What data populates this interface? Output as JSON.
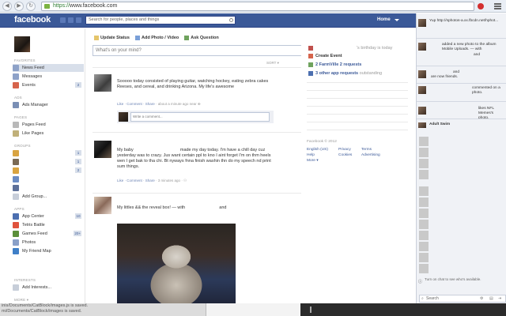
{
  "browser": {
    "url_scheme": "https://",
    "url_rest": "www.facebook.com",
    "back": "◀",
    "forward": "▶",
    "reload": "↻"
  },
  "header": {
    "logo": "facebook",
    "search_placeholder": "Search for people, places and things",
    "home": "Home"
  },
  "left": {
    "favorites_label": "FAVORITES",
    "favorites": [
      {
        "label": "News Feed",
        "count": ""
      },
      {
        "label": "Messages",
        "count": ""
      },
      {
        "label": "Events",
        "count": "2"
      }
    ],
    "ads_label": "ADS",
    "ads_manager": "Ads Manager",
    "pages_label": "PAGES",
    "pages_feed": "Pages Feed",
    "like_pages": "Like Pages",
    "groups_label": "GROUPS",
    "group_counts": [
      "1",
      "1",
      "2",
      ""
    ],
    "add_group": "Add Group...",
    "apps_label": "APPS",
    "apps": [
      {
        "label": "App Center",
        "count": "10"
      },
      {
        "label": "Tetris Battle",
        "count": ""
      },
      {
        "label": "Games Feed",
        "count": "20+"
      },
      {
        "label": "Photos",
        "count": ""
      },
      {
        "label": "My Friend Map",
        "count": ""
      }
    ],
    "interests_label": "INTERESTS",
    "add_interests": "Add Interests...",
    "more": "MORE ▾"
  },
  "composer": {
    "update_status": "Update Status",
    "add_photo": "Add Photo / Video",
    "ask_question": "Ask Question",
    "placeholder": "What's on your mind?",
    "sort": "SORT ▾"
  },
  "stories": [
    {
      "text": "Sooooo today consisted of playing guitar, watching hockey, eating zebra cakes Reeses, and cereal, and drinking Arizona. My life's awesome",
      "actions": "Like · Comment · Share",
      "time": "· about a minute ago near",
      "comment_placeholder": "Write a comment..."
    },
    {
      "text_a": "My baby",
      "text_b": "made my day today. I'm have a chill day cuz yesterday was to crazy. Jus want certain ppl to kno I aint forget I'm on thm heels wen I get bak to tha chi. Bt nyways fnna finish washin thn do my speech nd print sum things.",
      "actions": "Like · Comment · Share",
      "time": "· 3 minutes ago ·"
    },
    {
      "text_a": "My littles && the reveal box! — with",
      "text_b": "and"
    }
  ],
  "right": {
    "birthday": "'s birthday is today",
    "create_event": "Create Event",
    "farmville": "2 FarmVille 2 requests",
    "other_apps": "3 other app requests",
    "outstanding": "outstanding",
    "copyright": "Facebook © 2012",
    "lang": "English (US)",
    "privacy": "Privacy",
    "terms": "Terms",
    "help": "Help",
    "cookies": "Cookies",
    "advertising": "Advertising",
    "more": "More ▾"
  },
  "ticker": [
    {
      "text": "Yup http://sphotos-a.xx.fbcdn.net/hphot..."
    },
    {
      "text": "added a new photo to the album Mobile Uploads. — with",
      "extra": "and"
    },
    {
      "text": "and",
      "extra": "are now friends."
    },
    {
      "text": "commented on a photo."
    },
    {
      "text": "likes NFL Memes's photo."
    },
    {
      "text": "Adult Swim"
    }
  ],
  "chat": {
    "hint": "Turn on chat to see who's available.",
    "search": "Search"
  },
  "downloads": {
    "line1": "inis/Documents/CatBlock/images.js is saved.",
    "line2": "mi/Documents/CatBlock/images is saved."
  }
}
